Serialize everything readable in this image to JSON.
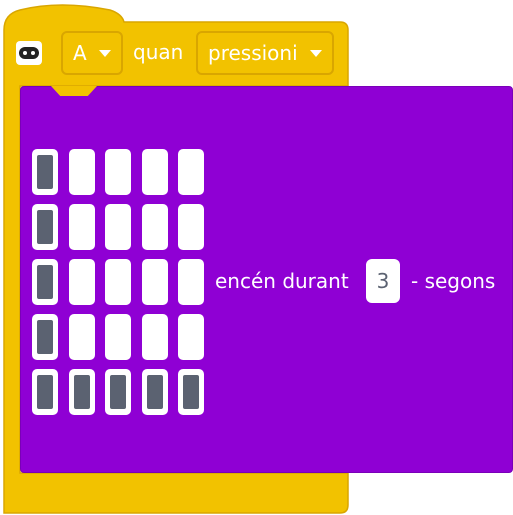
{
  "hat_block": {
    "extension_icon": "microbit-extension-icon",
    "button_value": "A",
    "label_when": "quan",
    "event_value": "pressioni",
    "color": "#F2C200"
  },
  "display_block": {
    "color": "#8F00D4",
    "led_matrix": [
      [
        1,
        0,
        0,
        0,
        0
      ],
      [
        1,
        0,
        0,
        0,
        0
      ],
      [
        1,
        0,
        0,
        0,
        0
      ],
      [
        1,
        0,
        0,
        0,
        0
      ],
      [
        1,
        1,
        1,
        1,
        1
      ]
    ],
    "label_on_for": "encén durant",
    "duration_value": "3",
    "label_seconds": "- segons"
  }
}
